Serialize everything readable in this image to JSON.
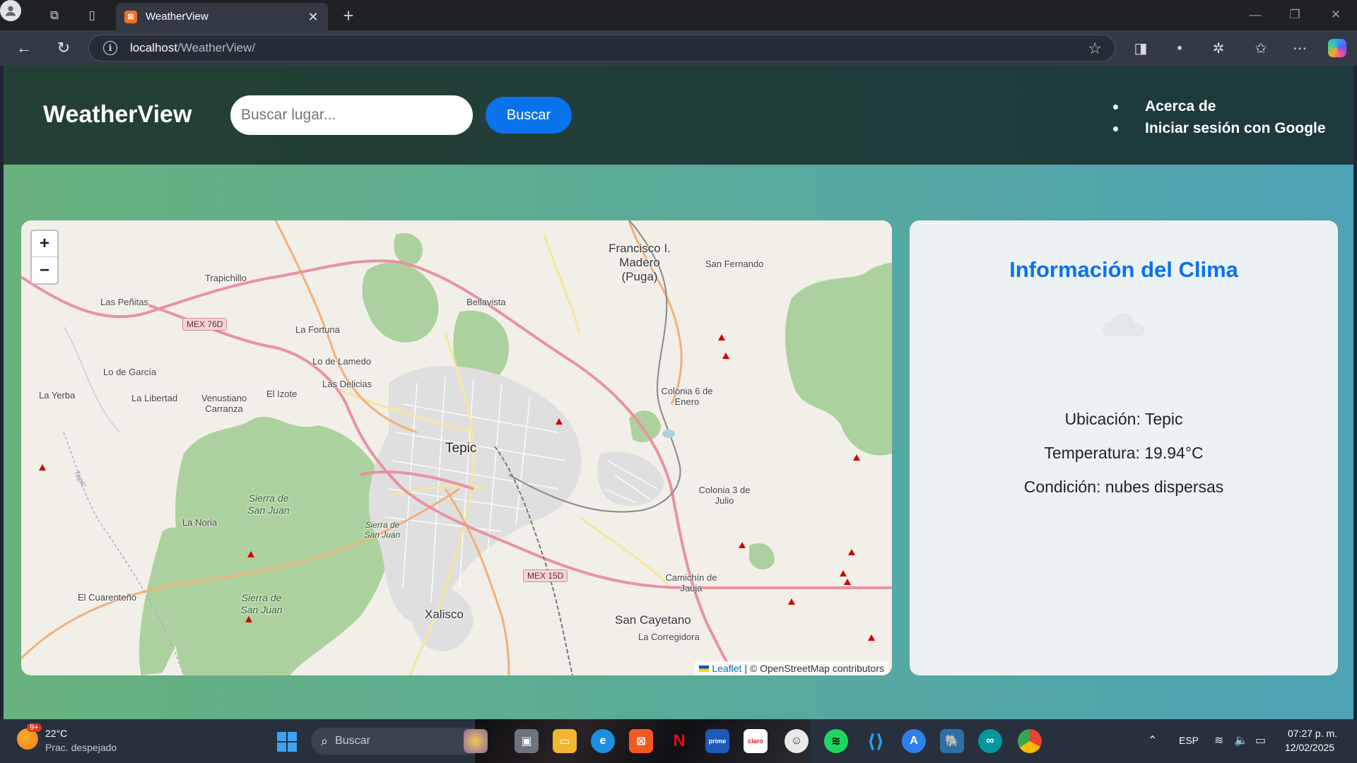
{
  "browser": {
    "tab_title": "WeatherView",
    "tab_favicon": "xampp-icon",
    "url_host": "localhost",
    "url_path": "/WeatherView/"
  },
  "header": {
    "brand": "WeatherView",
    "search_placeholder": "Buscar lugar...",
    "search_button": "Buscar",
    "nav": [
      "Acerca de",
      "Iniciar sesión con Google"
    ]
  },
  "map": {
    "zoom_in": "+",
    "zoom_out": "−",
    "attribution_link": "Leaflet",
    "attribution_text": "| © OpenStreetMap contributors",
    "places": {
      "tepic": "Tepic",
      "xalisco": "Xalisco",
      "san_cayetano": "San Cayetano",
      "la_corregidora": "La Corregidora",
      "francisco_madero": "Francisco I. Madero (Puga)",
      "san_fernando": "San Fernando",
      "trapichillo": "Trapichillo",
      "las_penitas": "Las Peñitas",
      "bellavista": "Bellavista",
      "la_fortuna": "La Fortuna",
      "lo_de_lamedo": "Lo de Lamedo",
      "las_delicias": "Las Delicias",
      "lo_de_garcia": "Lo de García",
      "la_yerba": "La Yerba",
      "la_libertad": "La Libertad",
      "venustiano_carranza": "Venustiano Carranza",
      "el_izote": "El Izote",
      "colonia_6_enero": "Colonia 6 de Enero",
      "colonia_3_julio": "Colonia 3 de Julio",
      "camichin": "Camichín de Jauja",
      "la_noria": "La Noria",
      "el_cuarenteno": "El Cuarenteño",
      "sierra_san_juan_1": "Sierra de San Juan",
      "sierra_san_juan_2": "Sierra de San Juan",
      "sierra_san_juan_3": "Sierra de San Juan",
      "tepic_river": "Tepic"
    },
    "shields": {
      "mex76d": "MEX 76D",
      "mex15d": "MEX 15D"
    }
  },
  "weather": {
    "title": "Información del Clima",
    "icon": "cloud-icon",
    "location": "Ubicación: Tepic",
    "temperature": "Temperatura: 19.94°C",
    "condition": "Condición: nubes dispersas"
  },
  "taskbar": {
    "badge": "9+",
    "temp": "22°C",
    "condition": "Prac. despejado",
    "search": "Buscar",
    "language": "ESP",
    "time": "07:27 p. m.",
    "date": "12/02/2025"
  },
  "colors": {
    "accent": "#0a72ea",
    "header_bg": "#1d3a3c",
    "page_gradient_start": "#68b27e",
    "page_gradient_end": "#4ea2b5"
  }
}
